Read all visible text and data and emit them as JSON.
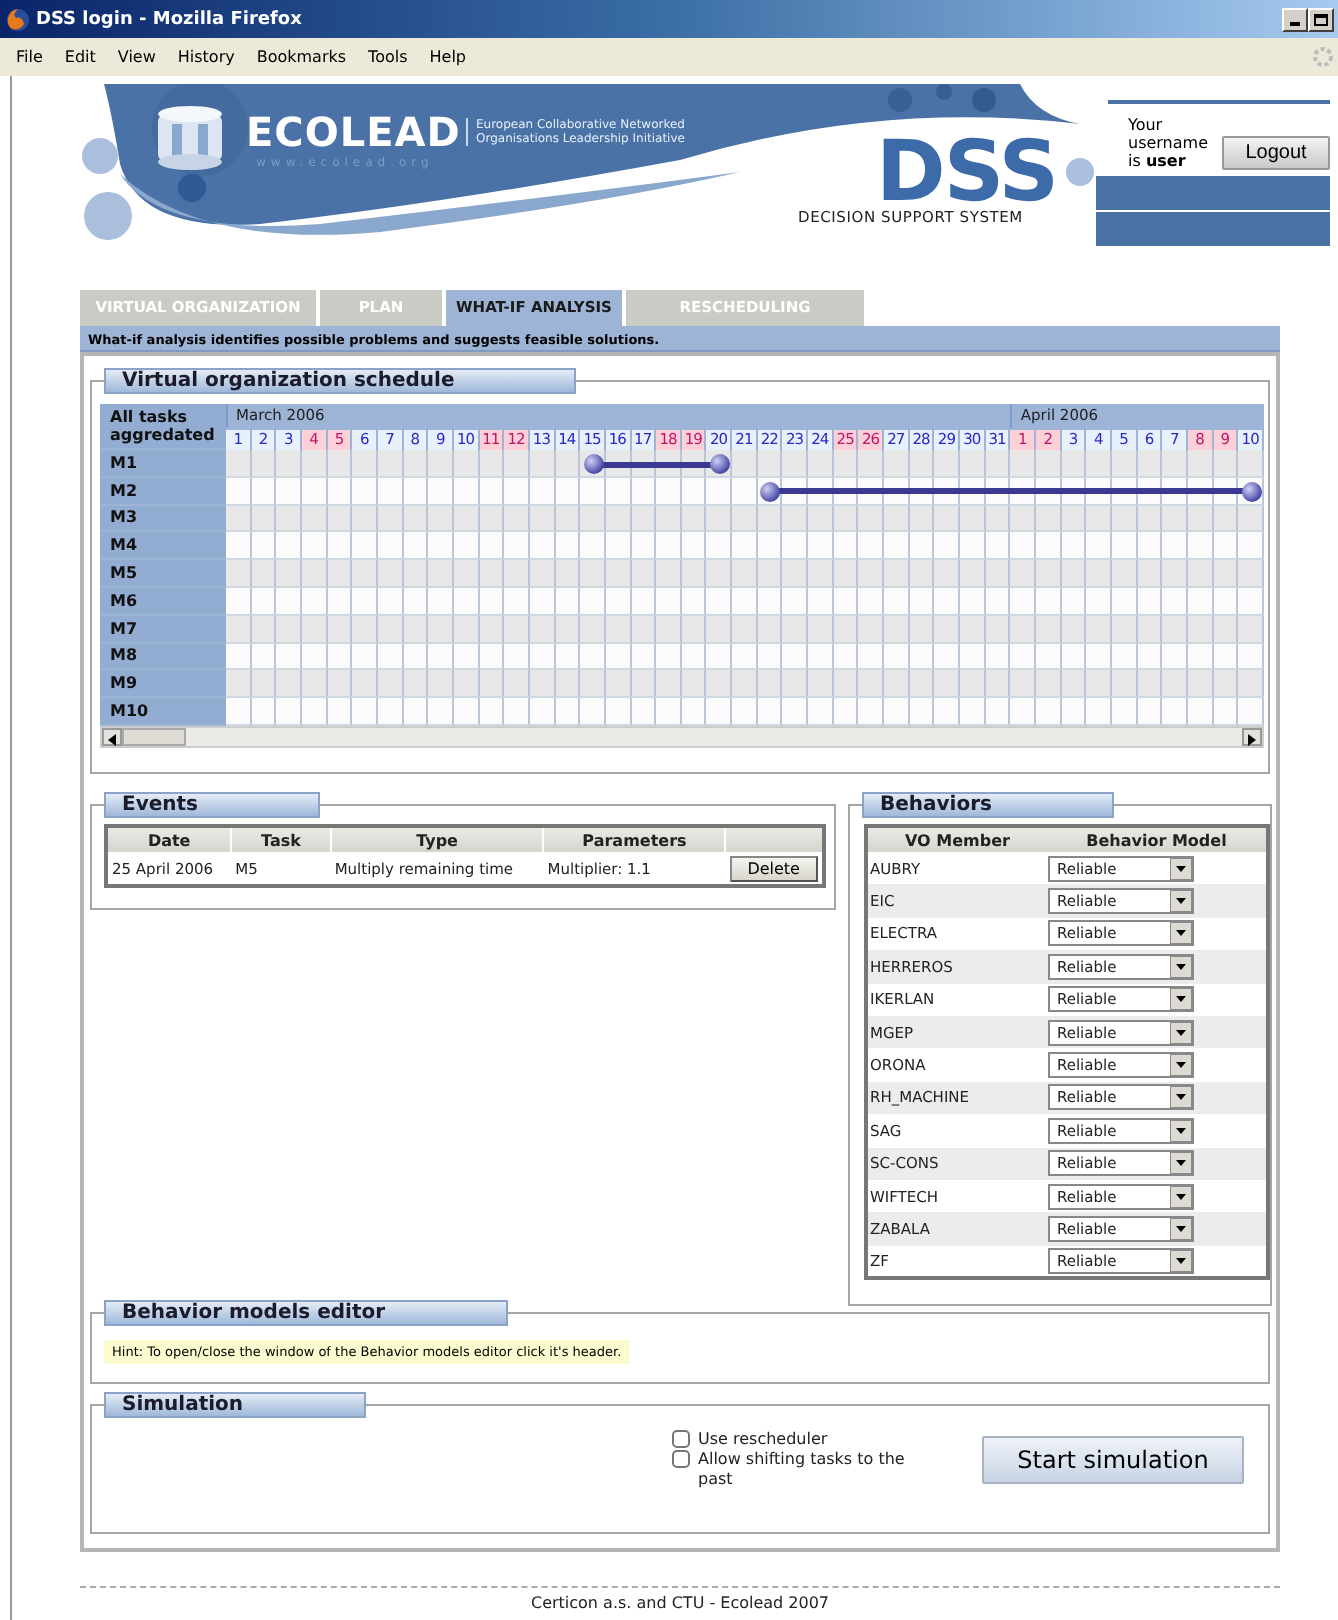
{
  "window": {
    "title": "DSS login - Mozilla Firefox"
  },
  "menu": [
    "File",
    "Edit",
    "View",
    "History",
    "Bookmarks",
    "Tools",
    "Help"
  ],
  "banner": {
    "logo": "ECOLEAD",
    "tagline": [
      "European Collaborative Networked",
      "Organisations Leadership Initiative"
    ],
    "url": "www.ecolead.org",
    "product": "DSS",
    "product_name": "DECISION SUPPORT SYSTEM",
    "user_text": "Your username is **user**",
    "logout": "Logout"
  },
  "tabs": [
    {
      "label": "VIRTUAL ORGANIZATION",
      "selected": false
    },
    {
      "label": "PLAN",
      "selected": false
    },
    {
      "label": "WHAT-IF ANALYSIS",
      "selected": true
    },
    {
      "label": "RESCHEDULING",
      "selected": false
    }
  ],
  "info": "What-if analysis identifies possible problems and suggests feasible solutions.",
  "schedule": {
    "title": "Virtual organization schedule",
    "corner": "All tasks aggredated",
    "months": [
      {
        "name": "March 2006",
        "days": [
          {
            "label": "1",
            "weekend": false
          },
          {
            "label": "2",
            "weekend": false
          },
          {
            "label": "3",
            "weekend": false
          },
          {
            "label": "4",
            "weekend": true
          },
          {
            "label": "5",
            "weekend": true
          },
          {
            "label": "6",
            "weekend": false
          },
          {
            "label": "7",
            "weekend": false
          },
          {
            "label": "8",
            "weekend": false
          },
          {
            "label": "9",
            "weekend": false
          },
          {
            "label": "10",
            "weekend": false
          },
          {
            "label": "11",
            "weekend": true
          },
          {
            "label": "12",
            "weekend": true
          },
          {
            "label": "13",
            "weekend": false
          },
          {
            "label": "14",
            "weekend": false
          },
          {
            "label": "15",
            "weekend": false
          },
          {
            "label": "16",
            "weekend": false
          },
          {
            "label": "17",
            "weekend": false
          },
          {
            "label": "18",
            "weekend": true
          },
          {
            "label": "19",
            "weekend": true
          },
          {
            "label": "20",
            "weekend": false
          },
          {
            "label": "21",
            "weekend": false
          },
          {
            "label": "22",
            "weekend": false
          },
          {
            "label": "23",
            "weekend": false
          },
          {
            "label": "24",
            "weekend": false
          },
          {
            "label": "25",
            "weekend": true
          },
          {
            "label": "26",
            "weekend": true
          },
          {
            "label": "27",
            "weekend": false
          },
          {
            "label": "28",
            "weekend": false
          },
          {
            "label": "29",
            "weekend": false
          },
          {
            "label": "30",
            "weekend": false
          },
          {
            "label": "31",
            "weekend": false
          }
        ]
      },
      {
        "name": "April 2006",
        "days": [
          {
            "label": "1",
            "weekend": true
          },
          {
            "label": "2",
            "weekend": true
          },
          {
            "label": "3",
            "weekend": false
          },
          {
            "label": "4",
            "weekend": false
          },
          {
            "label": "5",
            "weekend": false
          },
          {
            "label": "6",
            "weekend": false
          },
          {
            "label": "7",
            "weekend": false
          },
          {
            "label": "8",
            "weekend": true
          },
          {
            "label": "9",
            "weekend": true
          },
          {
            "label": "10",
            "weekend": false
          }
        ]
      }
    ],
    "rows": [
      {
        "label": "M1",
        "bar_days": [
          false,
          false,
          false,
          false,
          false,
          false,
          false,
          false,
          false,
          false,
          false,
          false,
          false,
          false,
          true,
          true,
          true,
          true,
          true,
          true,
          false,
          false,
          false,
          false,
          false,
          false,
          false,
          false,
          false,
          false,
          false,
          false,
          false,
          false,
          false,
          false,
          false,
          false,
          false,
          false,
          false
        ]
      },
      {
        "label": "M2",
        "bar_days": [
          false,
          false,
          false,
          false,
          false,
          false,
          false,
          false,
          false,
          false,
          false,
          false,
          false,
          false,
          false,
          false,
          false,
          false,
          false,
          false,
          false,
          true,
          true,
          true,
          true,
          true,
          true,
          true,
          true,
          true,
          true,
          true,
          true,
          true,
          true,
          true,
          true,
          true,
          true,
          true,
          true
        ]
      },
      {
        "label": "M3"
      },
      {
        "label": "M4"
      },
      {
        "label": "M5"
      },
      {
        "label": "M6"
      },
      {
        "label": "M7"
      },
      {
        "label": "M8"
      },
      {
        "label": "M9"
      },
      {
        "label": "M10"
      }
    ]
  },
  "events": {
    "title": "Events",
    "columns": [
      "Date",
      "Task",
      "Type",
      "Parameters"
    ],
    "rows": [
      {
        "date": "25 April 2006",
        "task": "M5",
        "type": "Multiply remaining time",
        "parameters": "Multiplier: 1.1",
        "action": "Delete"
      }
    ]
  },
  "behaviors": {
    "title": "Behaviors",
    "columns": [
      "VO Member",
      "Behavior Model"
    ],
    "rows": [
      {
        "member": "AUBRY",
        "model": "Reliable"
      },
      {
        "member": "EIC",
        "model": "Reliable"
      },
      {
        "member": "ELECTRA",
        "model": "Reliable"
      },
      {
        "member": "HERREROS",
        "model": "Reliable"
      },
      {
        "member": "IKERLAN",
        "model": "Reliable"
      },
      {
        "member": "MGEP",
        "model": "Reliable"
      },
      {
        "member": "ORONA",
        "model": "Reliable"
      },
      {
        "member": "RH_MACHINE",
        "model": "Reliable"
      },
      {
        "member": "SAG",
        "model": "Reliable"
      },
      {
        "member": "SC-CONS",
        "model": "Reliable"
      },
      {
        "member": "WIFTECH",
        "model": "Reliable"
      },
      {
        "member": "ZABALA",
        "model": "Reliable"
      },
      {
        "member": "ZF",
        "model": "Reliable"
      }
    ]
  },
  "editor": {
    "title": "Behavior models editor",
    "hint": "Hint: To open/close the window of the Behavior models editor click it's header."
  },
  "simulation": {
    "title": "Simulation",
    "options": [
      {
        "label": "Use rescheduler",
        "checked": false
      },
      {
        "label": "Allow shifting tasks to the past",
        "checked": false
      }
    ],
    "button": "Start simulation"
  },
  "footer": "Certicon a.s. and CTU - Ecolead 2007"
}
